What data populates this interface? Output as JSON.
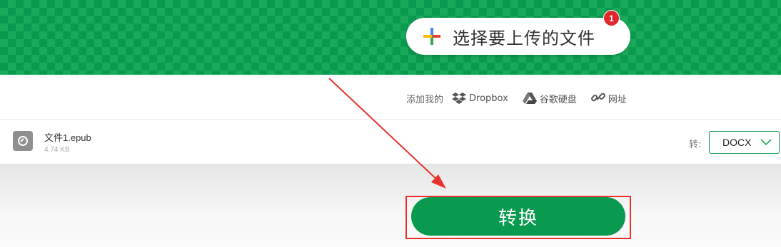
{
  "upload": {
    "label": "选择要上传的文件",
    "badge_count": "1"
  },
  "sources": {
    "add_label": "添加我的",
    "items": [
      {
        "label": "Dropbox",
        "icon": "dropbox-icon"
      },
      {
        "label": "谷歌硬盘",
        "icon": "google-drive-icon"
      },
      {
        "label": "网址",
        "icon": "link-icon"
      }
    ]
  },
  "file": {
    "name": "文件1.epub",
    "size": "4.74 KB",
    "to_label": "转:",
    "target_format": "DOCX"
  },
  "convert": {
    "label": "转换"
  },
  "colors": {
    "brand_green": "#0a9a4f",
    "badge_red": "#e0272e",
    "annotation_red": "#e8322c"
  }
}
